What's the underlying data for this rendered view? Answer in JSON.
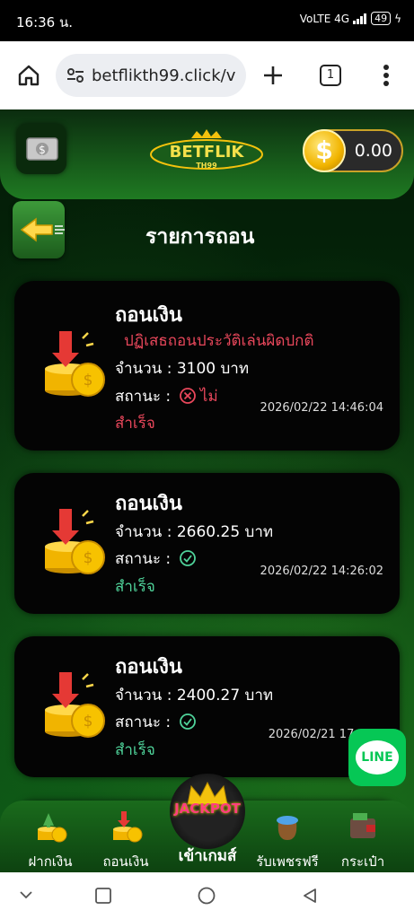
{
  "status_bar": {
    "time": "16:36 น.",
    "network": "VoLTE 4G",
    "battery": "49"
  },
  "browser": {
    "url": "betflikth99.click/v",
    "tab_count": "1"
  },
  "header": {
    "balance": "0.00",
    "logo_text": "BETFLIK",
    "logo_sub": "TH99"
  },
  "page": {
    "title": "รายการถอน"
  },
  "withdrawals": [
    {
      "title": "ถอนเงิน",
      "reason": "ปฏิเสธถอนประวัติเล่นผิดปกติ",
      "amount": "จำนวน : 3100 บาท",
      "status_label": "สถานะ :",
      "status_mark": "ไม่",
      "status_text": "สำเร็จ",
      "date": "2026/02/22 14:46:04"
    },
    {
      "title": "ถอนเงิน",
      "amount": "จำนวน : 2660.25 บาท",
      "status_label": "สถานะ :",
      "status_text": "สำเร็จ",
      "date": "2026/02/22 14:26:02"
    },
    {
      "title": "ถอนเงิน",
      "amount": "จำนวน : 2400.27 บาท",
      "status_label": "สถานะ :",
      "status_text": "สำเร็จ",
      "date": "2026/02/21 17:0"
    }
  ],
  "line_badge": {
    "label": "LINE"
  },
  "bottom_nav": {
    "deposit": "ฝากเงิน",
    "withdraw": "ถอนเงิน",
    "jackpot_badge": "JACKPOT",
    "enter_game": "เข้าเกมส์",
    "free_diamond": "รับเพชรฟรี",
    "wallet": "กระเป๋า"
  },
  "colors": {
    "accent_green": "#1f7a22",
    "fail_red": "#e8475b",
    "success_green": "#4fd39a",
    "gold": "#f1b400",
    "line_green": "#06c755"
  }
}
